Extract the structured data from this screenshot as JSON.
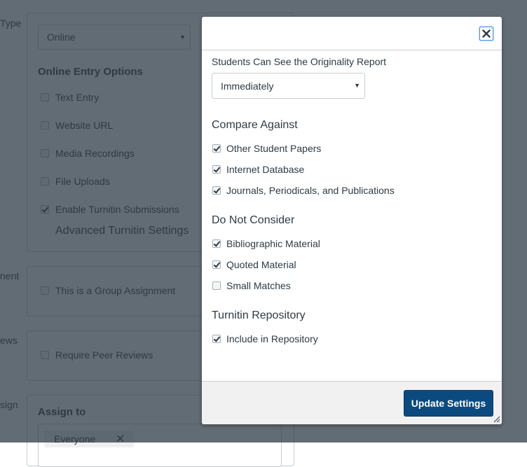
{
  "background": {
    "labels": {
      "submission_type": "Type",
      "group_assignment": "nent",
      "peer_reviews": "ews",
      "assign": "sign"
    },
    "submission_type_select": {
      "value": "Online"
    },
    "online_entry_heading": "Online Entry Options",
    "online_entry_options": [
      {
        "label": "Text Entry",
        "checked": false
      },
      {
        "label": "Website URL",
        "checked": false
      },
      {
        "label": "Media Recordings",
        "checked": false
      },
      {
        "label": "File Uploads",
        "checked": false
      },
      {
        "label": "Enable Turnitin Submissions",
        "checked": true
      }
    ],
    "advanced_turnitin_link": "Advanced Turnitin Settings",
    "group_assignment": {
      "label": "This is a Group Assignment",
      "checked": false
    },
    "peer_reviews": {
      "label": "Require Peer Reviews",
      "checked": false
    },
    "assign_to_heading": "Assign to",
    "assign_to_tag": {
      "label": "Everyone",
      "remove_icon": "close-x"
    }
  },
  "dialog": {
    "close_icon": "close-x",
    "originality_label": "Students Can See the Originality Report",
    "originality_select": {
      "value": "Immediately"
    },
    "sections": [
      {
        "title": "Compare Against",
        "options": [
          {
            "label": "Other Student Papers",
            "checked": true
          },
          {
            "label": "Internet Database",
            "checked": true
          },
          {
            "label": "Journals, Periodicals, and Publications",
            "checked": true
          }
        ]
      },
      {
        "title": "Do Not Consider",
        "options": [
          {
            "label": "Bibliographic Material",
            "checked": true
          },
          {
            "label": "Quoted Material",
            "checked": true
          },
          {
            "label": "Small Matches",
            "checked": false
          }
        ]
      },
      {
        "title": "Turnitin Repository",
        "options": [
          {
            "label": "Include in Repository",
            "checked": true
          }
        ]
      }
    ],
    "update_button": "Update Settings"
  },
  "colors": {
    "primary_button": "#0b4a7e",
    "focus_ring": "#4a90e2",
    "overlay": "#2d3b45"
  }
}
